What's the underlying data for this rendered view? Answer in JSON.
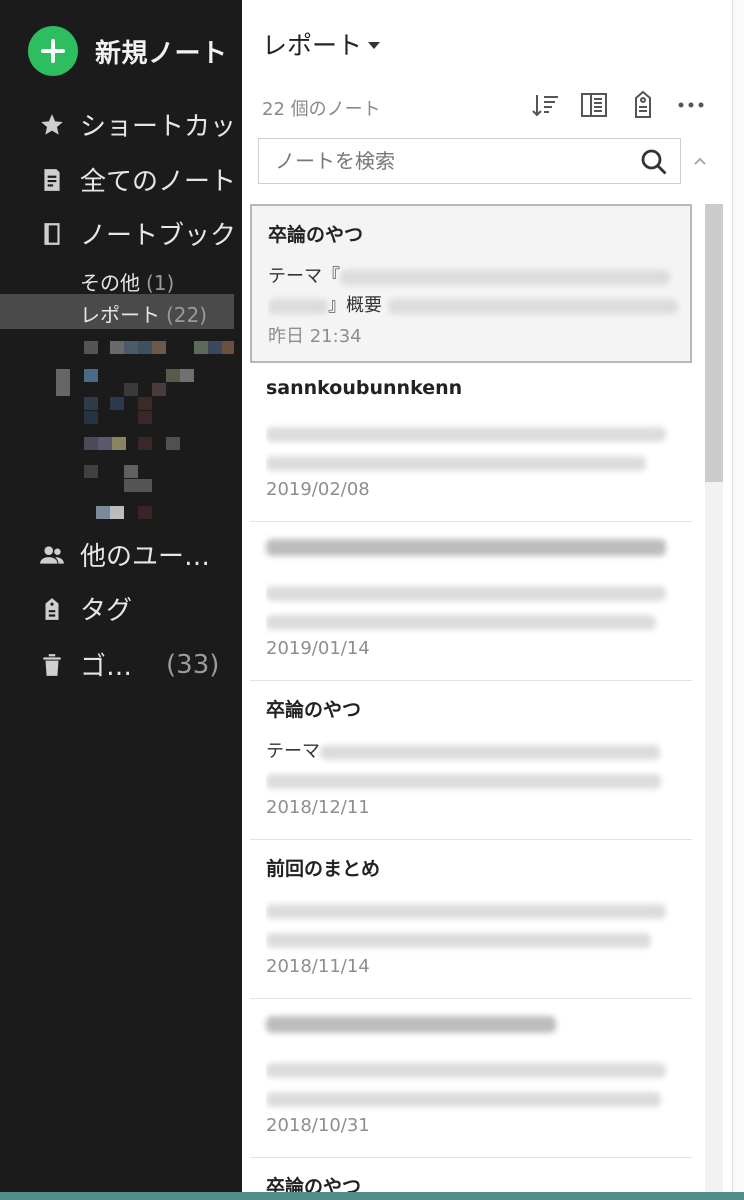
{
  "sidebar": {
    "new_note": "新規ノート",
    "items": [
      {
        "label": "ショートカット",
        "icon": "star-icon"
      },
      {
        "label": "全てのノート",
        "icon": "note-icon"
      },
      {
        "label": "ノートブック",
        "icon": "notebook-icon"
      },
      {
        "label": "他のユー…",
        "icon": "users-icon"
      },
      {
        "label": "タグ",
        "icon": "tag-icon"
      },
      {
        "label": "ゴ…",
        "icon": "trash-icon",
        "count": "(33)"
      }
    ],
    "notebooks": [
      {
        "label": "その他",
        "count": "(1)"
      },
      {
        "label": "レポート",
        "count": "(22)",
        "selected": true
      }
    ]
  },
  "list": {
    "title": "レポート",
    "count_label": "22 個のノート",
    "search_placeholder": "ノートを検索",
    "notes": [
      {
        "title": "卒論のやつ",
        "snippet_prefix": "テーマ『",
        "snippet_suffix": "』概要",
        "date": "昨日 21:34"
      },
      {
        "title": "sannkoubunnkenn",
        "date": "2019/02/08"
      },
      {
        "title": "",
        "date": "2019/01/14"
      },
      {
        "title": "卒論のやつ",
        "snippet_prefix": "テーマ",
        "date": "2018/12/11"
      },
      {
        "title": "前回のまとめ",
        "date": "2018/11/14"
      },
      {
        "title": "",
        "date": "2018/10/31"
      },
      {
        "title": "卒論のやつ",
        "date": ""
      }
    ]
  },
  "colors": {
    "accent_green": "#2dbe60",
    "sidebar_bg": "#1b1b1b",
    "selected_bg": "#4a4a4a"
  }
}
